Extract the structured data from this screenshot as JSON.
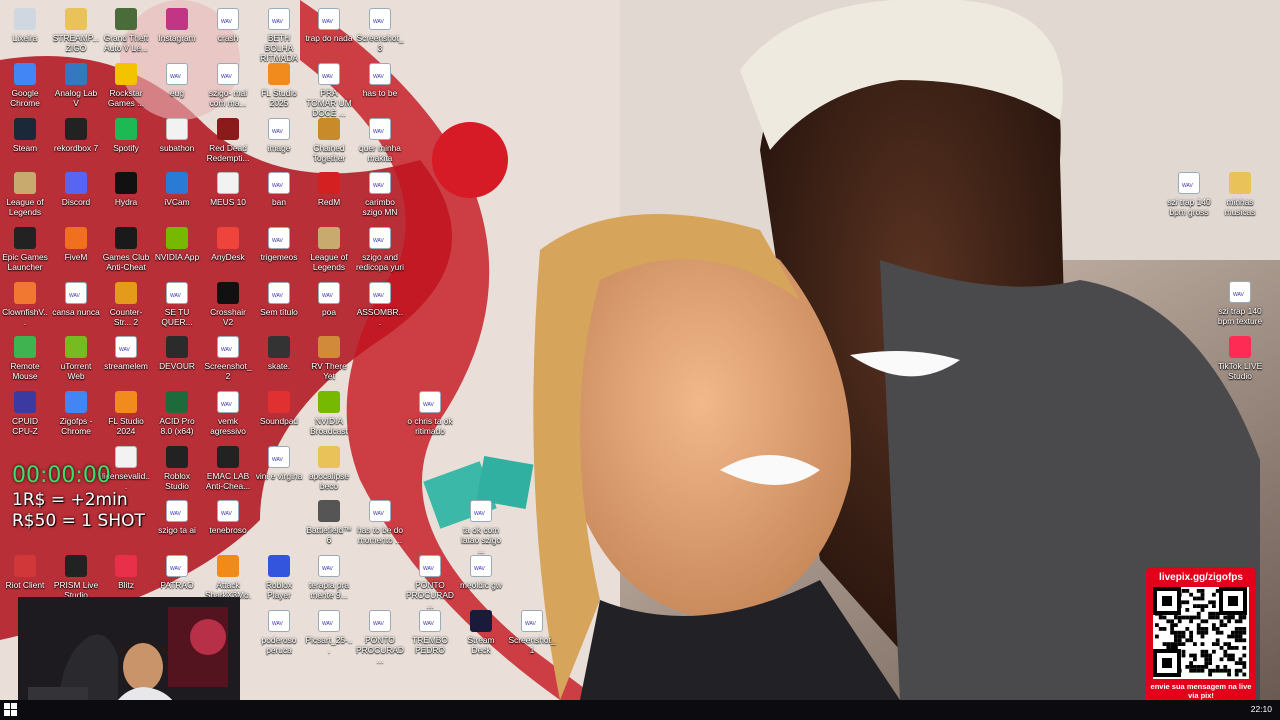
{
  "desktop_icons": [
    {
      "label": "Lixeira",
      "icon": "recycle-bin-icon",
      "color": "#cfd8e0",
      "col": 0,
      "row": 0
    },
    {
      "label": "STREAMP... ZIGO",
      "icon": "folder-icon",
      "color": "#e9c35a",
      "col": 1,
      "row": 0
    },
    {
      "label": "Grand Theft Auto V Le...",
      "icon": "gta-icon",
      "color": "#4a6b3a",
      "col": 2,
      "row": 0
    },
    {
      "label": "Instagram",
      "icon": "instagram-icon",
      "color": "#c13584",
      "col": 3,
      "row": 0
    },
    {
      "label": "crash",
      "icon": "wav-file-icon",
      "color": "#ffffff",
      "col": 4,
      "row": 0
    },
    {
      "label": "BETH BOLHA RITMADA (...",
      "icon": "wav-file-icon",
      "color": "#ffffff",
      "col": 5,
      "row": 0
    },
    {
      "label": "trap do nada",
      "icon": "wav-file-icon",
      "color": "#ffffff",
      "col": 6,
      "row": 0
    },
    {
      "label": "Screenshot_3",
      "icon": "image-file-icon",
      "color": "#ffffff",
      "col": 7,
      "row": 0
    },
    {
      "label": "Google Chrome",
      "icon": "chrome-icon",
      "color": "#4285f4",
      "col": 0,
      "row": 1
    },
    {
      "label": "Analog Lab V",
      "icon": "analog-lab-icon",
      "color": "#3478c0",
      "col": 1,
      "row": 1
    },
    {
      "label": "Rockstar Games ...",
      "icon": "rockstar-icon",
      "color": "#f3c300",
      "col": 2,
      "row": 1
    },
    {
      "label": "eug",
      "icon": "wav-file-icon",
      "color": "#ffffff",
      "col": 3,
      "row": 1
    },
    {
      "label": "szigo- mal com ma...",
      "icon": "wav-file-icon",
      "color": "#ffffff",
      "col": 4,
      "row": 1
    },
    {
      "label": "FL Studio 2025",
      "icon": "fl-studio-icon",
      "color": "#f28b1e",
      "col": 5,
      "row": 1
    },
    {
      "label": "PRA TOMAR UM DOCE ...",
      "icon": "wav-file-icon",
      "color": "#ffffff",
      "col": 6,
      "row": 1
    },
    {
      "label": "has to be",
      "icon": "wav-file-icon",
      "color": "#ffffff",
      "col": 7,
      "row": 1
    },
    {
      "label": "Steam",
      "icon": "steam-icon",
      "color": "#1b2838",
      "col": 0,
      "row": 2
    },
    {
      "label": "rekordbox 7",
      "icon": "rekordbox-icon",
      "color": "#222222",
      "col": 1,
      "row": 2
    },
    {
      "label": "Spotify",
      "icon": "spotify-icon",
      "color": "#1db954",
      "col": 2,
      "row": 2
    },
    {
      "label": "subathon",
      "icon": "blank-file-icon",
      "color": "#f2f2f2",
      "col": 3,
      "row": 2
    },
    {
      "label": "Red Dead Redempti...",
      "icon": "red-dead-icon",
      "color": "#8b1a1a",
      "col": 4,
      "row": 2
    },
    {
      "label": "image",
      "icon": "image-file-icon",
      "color": "#ffffff",
      "col": 5,
      "row": 2
    },
    {
      "label": "Chained Together",
      "icon": "chained-together-icon",
      "color": "#c98a2a",
      "col": 6,
      "row": 2
    },
    {
      "label": "quer minha makita",
      "icon": "wav-file-icon",
      "color": "#ffffff",
      "col": 7,
      "row": 2
    },
    {
      "label": "League of Legends",
      "icon": "league-icon",
      "color": "#c8aa6e",
      "col": 0,
      "row": 3
    },
    {
      "label": "Discord",
      "icon": "discord-icon",
      "color": "#5865f2",
      "col": 1,
      "row": 3
    },
    {
      "label": "Hydra",
      "icon": "hydra-icon",
      "color": "#111111",
      "col": 2,
      "row": 3
    },
    {
      "label": "iVCam",
      "icon": "ivcam-icon",
      "color": "#2a7bd6",
      "col": 3,
      "row": 3
    },
    {
      "label": "MEUS 10",
      "icon": "blank-file-icon",
      "color": "#f2f2f2",
      "col": 4,
      "row": 3
    },
    {
      "label": "ban",
      "icon": "wav-file-icon",
      "color": "#ffffff",
      "col": 5,
      "row": 3
    },
    {
      "label": "RedM",
      "icon": "redm-icon",
      "color": "#d42020",
      "col": 6,
      "row": 3
    },
    {
      "label": "carimbo szigo MN",
      "icon": "wav-file-icon",
      "color": "#ffffff",
      "col": 7,
      "row": 3
    },
    {
      "label": "Epic Games Launcher",
      "icon": "epic-games-icon",
      "color": "#222222",
      "col": 0,
      "row": 4
    },
    {
      "label": "FiveM",
      "icon": "fivem-icon",
      "color": "#f07020",
      "col": 1,
      "row": 4
    },
    {
      "label": "Games Club Anti-Cheat",
      "icon": "anticheat-icon",
      "color": "#1a1a1a",
      "col": 2,
      "row": 4
    },
    {
      "label": "NVIDIA App",
      "icon": "nvidia-icon",
      "color": "#76b900",
      "col": 3,
      "row": 4
    },
    {
      "label": "AnyDesk",
      "icon": "anydesk-icon",
      "color": "#ef443b",
      "col": 4,
      "row": 4
    },
    {
      "label": "trigemeos",
      "icon": "wav-file-icon",
      "color": "#ffffff",
      "col": 5,
      "row": 4
    },
    {
      "label": "League of Legends",
      "icon": "league-icon",
      "color": "#c8aa6e",
      "col": 6,
      "row": 4
    },
    {
      "label": "szigo and redicopa yuri",
      "icon": "wav-file-icon",
      "color": "#ffffff",
      "col": 7,
      "row": 4
    },
    {
      "label": "ClownfishV...",
      "icon": "clownfish-icon",
      "color": "#f07830",
      "col": 0,
      "row": 5
    },
    {
      "label": "cansa nunca",
      "icon": "wav-file-icon",
      "color": "#ffffff",
      "col": 1,
      "row": 5
    },
    {
      "label": "Counter-Str... 2",
      "icon": "cs2-icon",
      "color": "#e49b1b",
      "col": 2,
      "row": 5
    },
    {
      "label": "SE TU QUER...",
      "icon": "wav-file-icon",
      "color": "#ffffff",
      "col": 3,
      "row": 5
    },
    {
      "label": "Crosshair V2",
      "icon": "crosshair-icon",
      "color": "#111111",
      "col": 4,
      "row": 5
    },
    {
      "label": "Sem título",
      "icon": "image-file-icon",
      "color": "#ffffff",
      "col": 5,
      "row": 5
    },
    {
      "label": "poa",
      "icon": "wav-file-icon",
      "color": "#ffffff",
      "col": 6,
      "row": 5
    },
    {
      "label": "ASSOMBR...",
      "icon": "wav-file-icon",
      "color": "#ffffff",
      "col": 7,
      "row": 5
    },
    {
      "label": "Remote Mouse",
      "icon": "remote-mouse-icon",
      "color": "#3fb34f",
      "col": 0,
      "row": 6
    },
    {
      "label": "uTorrent Web",
      "icon": "utorrent-icon",
      "color": "#76bc21",
      "col": 1,
      "row": 6
    },
    {
      "label": "streamelem",
      "icon": "image-file-icon",
      "color": "#ffffff",
      "col": 2,
      "row": 6
    },
    {
      "label": "DEVOUR",
      "icon": "devour-icon",
      "color": "#2b2b2b",
      "col": 3,
      "row": 6
    },
    {
      "label": "Screenshot_2",
      "icon": "image-file-icon",
      "color": "#ffffff",
      "col": 4,
      "row": 6
    },
    {
      "label": "skate.",
      "icon": "skate-icon",
      "color": "#333333",
      "col": 5,
      "row": 6
    },
    {
      "label": "RV There Yet",
      "icon": "rv-there-yet-icon",
      "color": "#d08a3a",
      "col": 6,
      "row": 6
    },
    {
      "label": "CPUID CPU-Z",
      "icon": "cpuz-icon",
      "color": "#3a3aa0",
      "col": 0,
      "row": 7
    },
    {
      "label": "Zigofps - Chrome",
      "icon": "chrome-icon",
      "color": "#4285f4",
      "col": 1,
      "row": 7
    },
    {
      "label": "FL Studio 2024",
      "icon": "fl-studio-icon",
      "color": "#f28b1e",
      "col": 2,
      "row": 7
    },
    {
      "label": "ACID Pro 8.0 (x64)",
      "icon": "acid-pro-icon",
      "color": "#1d6b3a",
      "col": 3,
      "row": 7
    },
    {
      "label": "vemk agressivo",
      "icon": "wav-file-icon",
      "color": "#ffffff",
      "col": 4,
      "row": 7
    },
    {
      "label": "Soundpad",
      "icon": "soundpad-icon",
      "color": "#e03030",
      "col": 5,
      "row": 7
    },
    {
      "label": "NVIDIA Broadcast",
      "icon": "nvidia-broadcast-icon",
      "color": "#76b900",
      "col": 6,
      "row": 7
    },
    {
      "label": "o chris ta ok ritimado",
      "icon": "wav-file-icon",
      "color": "#ffffff",
      "col": 8,
      "row": 7
    },
    {
      "label": "licensevalid...",
      "icon": "blank-file-icon",
      "color": "#f2f2f2",
      "col": 2,
      "row": 8
    },
    {
      "label": "Roblox Studio",
      "icon": "roblox-studio-icon",
      "color": "#222222",
      "col": 3,
      "row": 8
    },
    {
      "label": "EMAC LAB Anti-Chea...",
      "icon": "emac-icon",
      "color": "#222222",
      "col": 4,
      "row": 8
    },
    {
      "label": "vini e virgina",
      "icon": "image-file-icon",
      "color": "#ffffff",
      "col": 5,
      "row": 8
    },
    {
      "label": "apocalipse beco",
      "icon": "folder-icon",
      "color": "#e9c35a",
      "col": 6,
      "row": 8
    },
    {
      "label": "szigo ta ai",
      "icon": "wav-file-icon",
      "color": "#ffffff",
      "col": 3,
      "row": 9
    },
    {
      "label": "tenebroso",
      "icon": "wav-file-icon",
      "color": "#ffffff",
      "col": 4,
      "row": 9
    },
    {
      "label": "Battlefield™ 6",
      "icon": "battlefield-icon",
      "color": "#555555",
      "col": 6,
      "row": 9
    },
    {
      "label": "has to be do momento ...",
      "icon": "wav-file-icon",
      "color": "#ffffff",
      "col": 7,
      "row": 9
    },
    {
      "label": "ta ok com latao szigo ...",
      "icon": "wav-file-icon",
      "color": "#ffffff",
      "col": 9,
      "row": 9
    },
    {
      "label": "Riot Client",
      "icon": "riot-client-icon",
      "color": "#d13639",
      "col": 0,
      "row": 10
    },
    {
      "label": "PRISM Live Studio",
      "icon": "prism-live-icon",
      "color": "#222222",
      "col": 1,
      "row": 10
    },
    {
      "label": "Blitz",
      "icon": "blitz-icon",
      "color": "#e8304a",
      "col": 2,
      "row": 10
    },
    {
      "label": "PATRAO",
      "icon": "wav-file-icon",
      "color": "#ffffff",
      "col": 3,
      "row": 10
    },
    {
      "label": "Attack SharkX3Mo...",
      "icon": "attack-shark-icon",
      "color": "#f08a18",
      "col": 4,
      "row": 10
    },
    {
      "label": "Roblox Player",
      "icon": "roblox-icon",
      "color": "#3355dd",
      "col": 5,
      "row": 10
    },
    {
      "label": "terapia pra mente 9...",
      "icon": "wav-file-icon",
      "color": "#ffffff",
      "col": 6,
      "row": 10
    },
    {
      "label": "PONTO PROCURAD...",
      "icon": "wav-file-icon",
      "color": "#ffffff",
      "col": 8,
      "row": 10
    },
    {
      "label": "meoldic gw",
      "icon": "wav-file-icon",
      "color": "#ffffff",
      "col": 9,
      "row": 10
    },
    {
      "label": "poderoso peruca",
      "icon": "wav-file-icon",
      "color": "#ffffff",
      "col": 5,
      "row": 11
    },
    {
      "label": "Picsart_25-...",
      "icon": "image-file-icon",
      "color": "#ffffff",
      "col": 6,
      "row": 11
    },
    {
      "label": "PONTO PROCURAD...",
      "icon": "wav-file-icon",
      "color": "#ffffff",
      "col": 7,
      "row": 11
    },
    {
      "label": "TREMBO PEDRO",
      "icon": "wav-file-icon",
      "color": "#ffffff",
      "col": 8,
      "row": 11
    },
    {
      "label": "Stream Deck",
      "icon": "stream-deck-icon",
      "color": "#1a1a3a",
      "col": 9,
      "row": 11
    },
    {
      "label": "Screenshot_1",
      "icon": "image-file-icon",
      "color": "#ffffff",
      "col": 10,
      "row": 11
    }
  ],
  "right_icons": [
    {
      "label": "szi trap 140 bpm gross",
      "icon": "wav-file-icon",
      "color": "#ffffff",
      "slot": "a"
    },
    {
      "label": "minhas musicas",
      "icon": "folder-icon",
      "color": "#e9c35a",
      "slot": "b"
    },
    {
      "label": "szi trap 140 bpm texture",
      "icon": "wav-file-icon",
      "color": "#ffffff",
      "slot": "c"
    },
    {
      "label": "TikTok LIVE Studio",
      "icon": "tiktok-live-icon",
      "color": "#fe2c55",
      "slot": "d"
    }
  ],
  "overlay": {
    "timer": "00:00:00",
    "rate_line": "1R$ = +2min",
    "shot_line": "R$50 = 1 SHOT"
  },
  "qr_panel": {
    "title": "livepix.gg/zigofps",
    "caption": "envie sua mensagem na live via pix!",
    "color": "#e2001a"
  },
  "taskbar": {
    "clock": "22:10"
  }
}
